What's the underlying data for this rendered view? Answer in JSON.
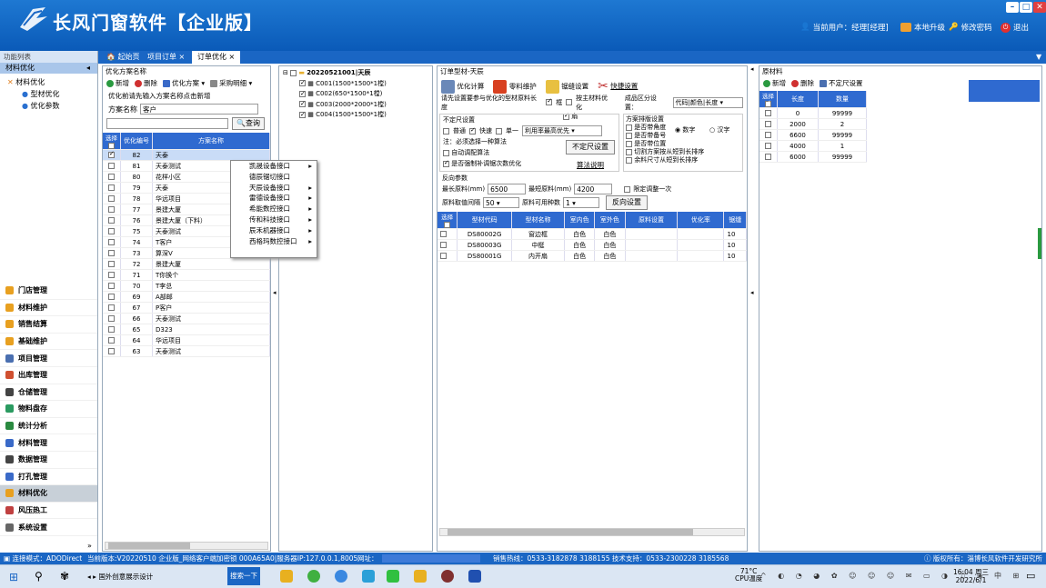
{
  "app": {
    "title": "长风门窗软件【企业版】",
    "current_user": "当前用户：经理[经理]",
    "upgrade": "本地升级",
    "change_pwd": "修改密码",
    "exit": "退出"
  },
  "tabs": [
    "起始页",
    "项目订单",
    "订单优化"
  ],
  "nav": {
    "header": "功能列表",
    "group": "材料优化",
    "tree_root": "材料优化",
    "tree_items": [
      "型材优化",
      "优化参数"
    ],
    "menu": [
      "门店管理",
      "材料维护",
      "销售结算",
      "基础维护",
      "项目管理",
      "出库管理",
      "仓储管理",
      "物料盘存",
      "统计分析",
      "材料管理",
      "数据管理",
      "打孔管理",
      "材料优化",
      "风压热工",
      "系统设置"
    ],
    "menu_colors": [
      "#e8a020",
      "#e8a020",
      "#e8a020",
      "#e8a020",
      "#4a6fb0",
      "#d05030",
      "#444",
      "#2a9a60",
      "#2a8a40",
      "#3a6ac8",
      "#444",
      "#3a6ac8",
      "#e8a020",
      "#c04040",
      "#666"
    ]
  },
  "plan": {
    "title": "优化方案名称",
    "new": "新增",
    "delete": "删除",
    "optimize": "优化方案",
    "purchase": "采购明细",
    "hint": "优化前请先输入方案名称点击新增",
    "name_label": "方案名称",
    "name_value": "客户",
    "query": "查询",
    "cols": [
      "选择",
      "优化编号",
      "方案名称"
    ],
    "rows": [
      [
        "82",
        "天泰"
      ],
      [
        "81",
        "天泰测试"
      ],
      [
        "80",
        "花样小区"
      ],
      [
        "79",
        "天泰"
      ],
      [
        "78",
        "华远项目"
      ],
      [
        "77",
        "景建大厦"
      ],
      [
        "76",
        "景建大厦（下料）"
      ],
      [
        "75",
        "天泰测试"
      ],
      [
        "74",
        "T客户"
      ],
      [
        "73",
        "算深V"
      ],
      [
        "72",
        "景建大厦"
      ],
      [
        "71",
        "T你换个"
      ],
      [
        "70",
        "T李总"
      ],
      [
        "69",
        "A部邮"
      ],
      [
        "67",
        "P客户"
      ],
      [
        "66",
        "天泰测试"
      ],
      [
        "65",
        "D323"
      ],
      [
        "64",
        "华远项目"
      ],
      [
        "63",
        "天泰测试"
      ]
    ]
  },
  "context_menu": [
    "凯晟设备接口",
    "德辰锯切接口",
    "天辰设备接口",
    "雷德设备接口",
    "希能数控接口",
    "传和科技接口",
    "辰禾机器接口",
    "西格玛数控接口"
  ],
  "tree": {
    "root": "20220521001|天辰",
    "items": [
      "C001(1500*1500*1樘)",
      "C002(650*1500*1樘)",
      "C003(2000*2000*1樘)",
      "C004(1500*1500*1樘)"
    ]
  },
  "order": {
    "title": "订单型材-天辰",
    "tools": [
      "优化计算",
      "零料维护",
      "锯缝设置",
      "快捷设置"
    ],
    "note": "请先设置要参与优化的型材原料长度",
    "frame": "框",
    "sash": "扇",
    "by_material": "按主材料优化",
    "cut_label": "成品区分设置：",
    "cut_value": "代码|颜色|长度",
    "indef_title": "不定尺设置",
    "normal": "普通",
    "fast": "快速",
    "single": "单一",
    "util_value": "利用率最高优先",
    "must_one": "注：必须选择一种算法",
    "auto_alg": "自动调配算法",
    "force": "是否强制补调锯次数优化",
    "indef_btn": "不定尺设置",
    "algo_desc": "算法说明",
    "sort_title": "方案排版设置",
    "sort_items": [
      "是否带角度",
      "是否带备号",
      "是否带位置",
      "切割方案按从短到长排序",
      "余料尺寸从短到长排序"
    ],
    "radio_num": "数字",
    "radio_cn": "汉字",
    "rev_title": "反向参数",
    "max_label": "最长原料(mm)",
    "max_val": "6500",
    "min_label": "最短原料(mm)",
    "min_val": "4200",
    "limit": "限定调整一次",
    "gap_label": "原料取值间隔",
    "gap_val": "50",
    "kinds_label": "原料可用种数",
    "kinds_val": "1",
    "rev_btn": "反向设置",
    "cols": [
      "选择",
      "型材代码",
      "型材名称",
      "室内色",
      "室外色",
      "原料设置",
      "优化率",
      "锯缝"
    ],
    "rows": [
      [
        "DS80002G",
        "窗边框",
        "白色",
        "白色",
        "",
        "",
        "10"
      ],
      [
        "DS80003G",
        "中梃",
        "白色",
        "白色",
        "",
        "",
        "10"
      ],
      [
        "DS80001G",
        "内开扇",
        "白色",
        "白色",
        "",
        "",
        "10"
      ]
    ]
  },
  "raw": {
    "title": "原材料",
    "new": "新增",
    "delete": "删除",
    "indef": "不定尺设置",
    "cols": [
      "选择",
      "长度",
      "数量"
    ],
    "rows": [
      [
        "0",
        "99999"
      ],
      [
        "2000",
        "2"
      ],
      [
        "6600",
        "99999"
      ],
      [
        "4000",
        "1"
      ],
      [
        "6000",
        "99999"
      ]
    ]
  },
  "status": {
    "mode": "连接模式：ADODirect",
    "version": "当前版本:V20220510 企业版_网络客户端加密锁 000A65A0|服务器IP:127.0.0.1,8005",
    "site": "网址：",
    "hotline": "销售热线：0533-3182878 3188155 技术支持：0533-2300228 3185568",
    "copyright": "版权所有：淄博长风软件开发研究所"
  },
  "taskbar": {
    "app": "国外创意展示设计",
    "active": "搜索一下",
    "temp": "71°C",
    "cpu": "CPU温度",
    "time": "16:04 周三",
    "date": "2022/6/1"
  }
}
